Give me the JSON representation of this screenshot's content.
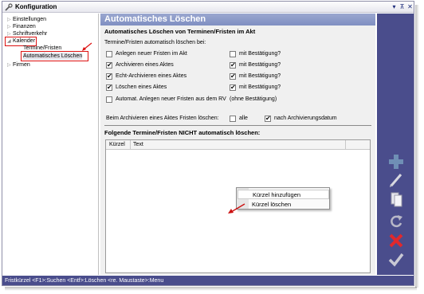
{
  "window": {
    "title": "Konfiguration",
    "controls": [
      "▾",
      "⊼",
      "✕"
    ]
  },
  "tree": {
    "items": [
      {
        "label": "Einstellungen",
        "expander": "▷"
      },
      {
        "label": "Finanzen",
        "expander": "▷"
      },
      {
        "label": "Schriftverkehr",
        "expander": "▷"
      },
      {
        "label": "Kalender",
        "expander": "◢"
      },
      {
        "label": "Termine/Fristen",
        "expander": ""
      },
      {
        "label": "Automatisches Löschen",
        "expander": ""
      },
      {
        "label": "Firmen",
        "expander": "▷"
      }
    ]
  },
  "main": {
    "header": "Automatisches Löschen",
    "section1_title": "Automatisches Löschen von Terminen/Fristen im Akt",
    "intro": "Termine/Fristen automatisch löschen bei:",
    "rows": [
      {
        "label": "Anlegen neuer Fristen im Akt",
        "checked": false,
        "confirm_label": "mit Bestätigung?",
        "confirm_checked": false
      },
      {
        "label": "Archivieren eines Aktes",
        "checked": true,
        "confirm_label": "mit Bestätigung?",
        "confirm_checked": true
      },
      {
        "label": "Echt-Archivieren eines Aktes",
        "checked": true,
        "confirm_label": "mit Bestätigung?",
        "confirm_checked": true
      },
      {
        "label": "Löschen eines Aktes",
        "checked": true,
        "confirm_label": "mit Bestätigung?",
        "confirm_checked": true
      },
      {
        "label": "Automat. Anlegen neuer Fristen aus dem RV",
        "checked": false,
        "confirm_label": "(ohne Bestätigung)"
      }
    ],
    "archive_line": {
      "label": "Beim Archivieren eines Aktes Fristen löschen:",
      "opt_all": "alle",
      "opt_all_checked": false,
      "opt_after": "nach Archivierungsdatum",
      "opt_after_checked": true
    },
    "section2_title": "Folgende Termine/Fristen NICHT automatisch löschen:",
    "grid_columns": [
      "Kürzel",
      "Text"
    ]
  },
  "context_menu": {
    "items": [
      "Kürzel hinzufügen",
      "Kürzel löschen"
    ]
  },
  "right_toolbar": {
    "icons": [
      "plus-icon",
      "pencil-icon",
      "copy-icon",
      "refresh-icon",
      "delete-icon",
      "check-icon"
    ]
  },
  "statusbar": {
    "text": "Fristkürzel  <F1>:Suchen  <Entf>:Löschen  <re. Maustaste>:Menu"
  },
  "colors": {
    "accent": "#4a4d8c",
    "header": "#8b99c8",
    "highlight": "#dd1111"
  }
}
